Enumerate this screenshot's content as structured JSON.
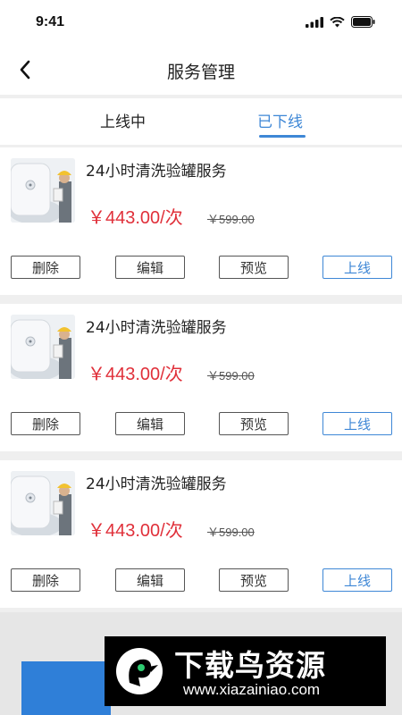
{
  "status_bar": {
    "time": "9:41"
  },
  "nav": {
    "title": "服务管理"
  },
  "tabs": [
    {
      "label": "上线中",
      "active": false
    },
    {
      "label": "已下线",
      "active": true
    }
  ],
  "colors": {
    "accent": "#3e87d6",
    "price": "#e0303a",
    "primary_button": "#2f7fd8"
  },
  "cards": [
    {
      "title": "24小时清洗验罐服务",
      "price": "￥443.00/次",
      "original_price": "￥599.00",
      "actions": {
        "delete": "删除",
        "edit": "编辑",
        "preview": "预览",
        "online": "上线"
      }
    },
    {
      "title": "24小时清洗验罐服务",
      "price": "￥443.00/次",
      "original_price": "￥599.00",
      "actions": {
        "delete": "删除",
        "edit": "编辑",
        "preview": "预览",
        "online": "上线"
      }
    },
    {
      "title": "24小时清洗验罐服务",
      "price": "￥443.00/次",
      "original_price": "￥599.00",
      "actions": {
        "delete": "删除",
        "edit": "编辑",
        "preview": "预览",
        "online": "上线"
      }
    }
  ],
  "watermark": {
    "title": "下载鸟资源",
    "url": "www.xiazainiao.com"
  }
}
